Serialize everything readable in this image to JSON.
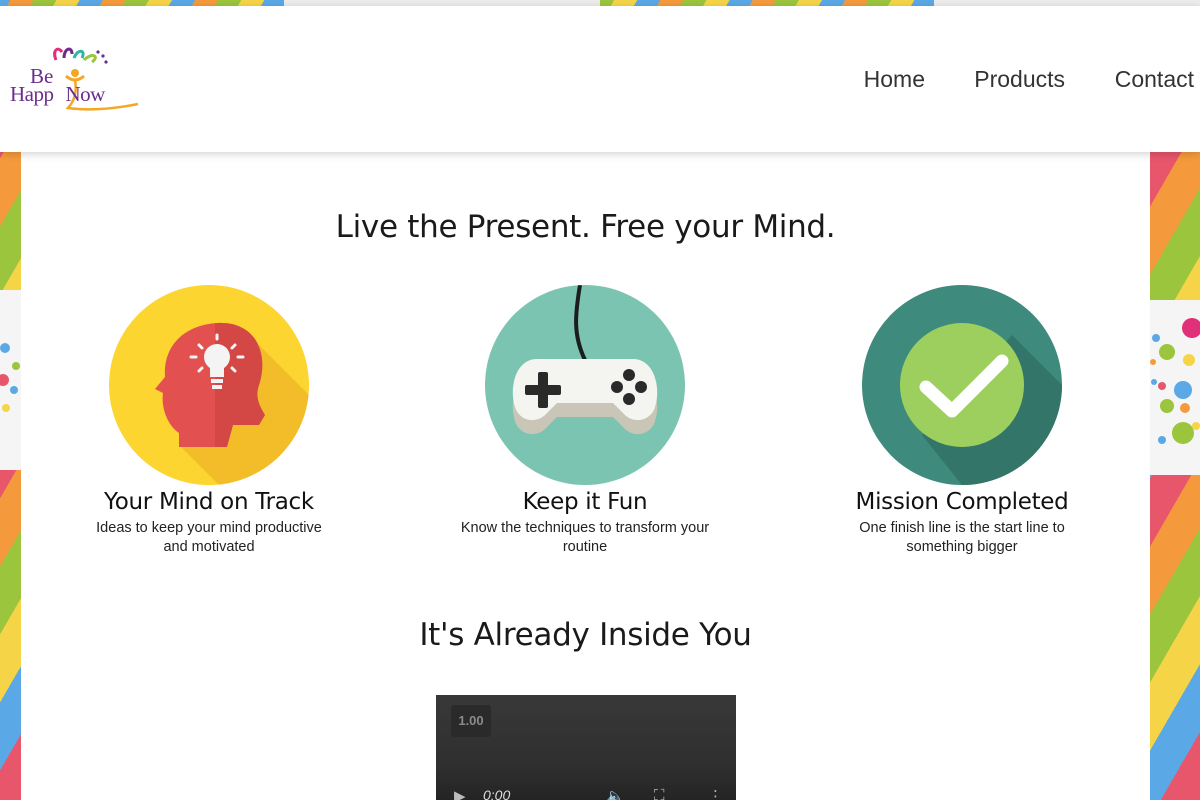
{
  "brand": {
    "logo_line1": "Be",
    "logo_line2_a": "Happ",
    "logo_line2_b": "Now",
    "colors": {
      "purple": "#6a2c8e",
      "orange": "#f5a623",
      "teal": "#2fb5a6",
      "pink": "#e0307a"
    }
  },
  "nav": {
    "items": [
      "Home",
      "Products",
      "Contact"
    ]
  },
  "main": {
    "headline": "Live the Present. Free your Mind.",
    "features": [
      {
        "icon": "head-lightbulb-icon",
        "title": "Your Mind on Track",
        "description": "Ideas to keep your mind productive and motivated",
        "circle_color": "#fdd531"
      },
      {
        "icon": "gamepad-icon",
        "title": "Keep it Fun",
        "description": "Know the techniques to transform your routine",
        "circle_color": "#7cc4b2"
      },
      {
        "icon": "checkmark-icon",
        "title": "Mission Completed",
        "description": "One finish line is the start line to something bigger",
        "circle_color": "#3e8a7c"
      }
    ],
    "video_heading": "It's Already Inside You",
    "video": {
      "speed_label": "1.00",
      "time": "0:00",
      "play_icon": "play-icon",
      "volume_icon": "volume-icon",
      "fullscreen_icon": "fullscreen-icon",
      "more_icon": "more-vert-icon"
    }
  }
}
